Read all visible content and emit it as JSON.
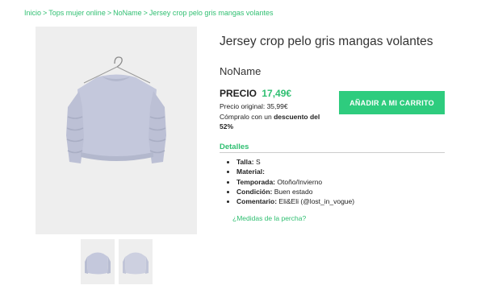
{
  "breadcrumb": {
    "items": [
      "Inicio",
      "Tops mujer online",
      "NoName",
      "Jersey crop pelo gris mangas volantes"
    ],
    "separator": ">"
  },
  "product": {
    "title": "Jersey crop pelo gris mangas volantes",
    "brand": "NoName",
    "price_label": "PRECIO",
    "price": "17,49€",
    "original_price_text": "Precio original: 35,99€",
    "discount_prefix": "Cómpralo con un",
    "discount_emphasis": "descuento del 52%"
  },
  "cart_button": {
    "label": "AÑADIR A MI CARRITO"
  },
  "details": {
    "heading": "Detalles",
    "items": [
      {
        "key": "Talla:",
        "value": " S"
      },
      {
        "key": "Material:",
        "value": ""
      },
      {
        "key": "Temporada:",
        "value": " Otoño/Invierno"
      },
      {
        "key": "Condición:",
        "value": " Buen estado"
      },
      {
        "key": "Comentario:",
        "value": " Eli&Eli (@lost_in_vogue)"
      }
    ]
  },
  "size_guide_link": "¿Medidas de la percha?",
  "colors": {
    "accent": "#2fbf71",
    "button": "#2ecc7e",
    "image_bg": "#eeeeee",
    "sweater": "#c4c8dc"
  },
  "icons": {
    "main_image": "sweater-photo",
    "thumbnails": [
      "sweater-front-thumb",
      "sweater-back-thumb"
    ]
  }
}
